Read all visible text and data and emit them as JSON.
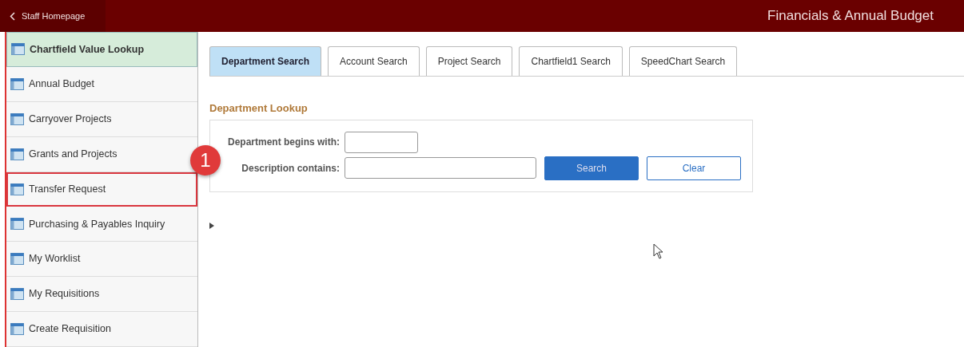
{
  "header": {
    "back_label": "Staff Homepage",
    "title": "Financials & Annual Budget"
  },
  "sidebar": {
    "items": [
      {
        "label": "Chartfield Value Lookup",
        "selected": true,
        "highlighted": false
      },
      {
        "label": "Annual Budget",
        "selected": false,
        "highlighted": false
      },
      {
        "label": "Carryover Projects",
        "selected": false,
        "highlighted": false
      },
      {
        "label": "Grants and Projects",
        "selected": false,
        "highlighted": false
      },
      {
        "label": "Transfer Request",
        "selected": false,
        "highlighted": true
      },
      {
        "label": "Purchasing & Payables Inquiry",
        "selected": false,
        "highlighted": false
      },
      {
        "label": "My Worklist",
        "selected": false,
        "highlighted": false
      },
      {
        "label": "My Requisitions",
        "selected": false,
        "highlighted": false
      },
      {
        "label": "Create Requisition",
        "selected": false,
        "highlighted": false
      }
    ]
  },
  "callout": {
    "number": "1"
  },
  "tabs": [
    {
      "label": "Department Search",
      "selected": true
    },
    {
      "label": "Account Search",
      "selected": false
    },
    {
      "label": "Project Search",
      "selected": false
    },
    {
      "label": "Chartfield1 Search",
      "selected": false
    },
    {
      "label": "SpeedChart Search",
      "selected": false
    }
  ],
  "lookup": {
    "title": "Department Lookup",
    "fields": [
      {
        "label": "Department begins with:",
        "kind": "short"
      },
      {
        "label": "Description contains:",
        "kind": "long"
      }
    ],
    "buttons": [
      {
        "label": "Search",
        "kind": "primary"
      },
      {
        "label": "Clear",
        "kind": "secondary"
      }
    ]
  }
}
